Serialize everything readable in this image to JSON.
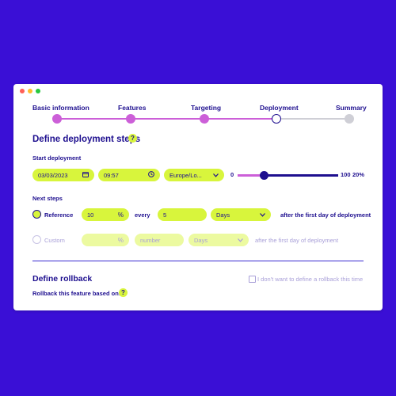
{
  "window": {
    "dot_colors": [
      "#ff5f57",
      "#ffbd2e",
      "#28c840"
    ]
  },
  "stepper": {
    "steps": [
      {
        "label": "Basic information",
        "state": "done"
      },
      {
        "label": "Features",
        "state": "done"
      },
      {
        "label": "Targeting",
        "state": "done"
      },
      {
        "label": "Deployment",
        "state": "current"
      },
      {
        "label": "Summary",
        "state": "todo"
      }
    ]
  },
  "deployment": {
    "title": "Define deployment steps",
    "help": "?",
    "start_label": "Start deployment",
    "date": "03/03/2023",
    "time": "09:57",
    "timezone": "Europe/Lo...",
    "slider": {
      "min": "0",
      "max": "100",
      "value_label": "20%",
      "value": 20
    },
    "next_label": "Next steps",
    "reference": {
      "label": "Reference",
      "percent": "10",
      "percent_sign": "%",
      "every": "every",
      "number": "5",
      "unit": "Days",
      "suffix": "after the first day of deployment"
    },
    "custom": {
      "label": "Custom",
      "percent_placeholder": "",
      "percent_sign": "%",
      "number_placeholder": "number",
      "unit": "Days",
      "suffix": "after the first day of deployment"
    }
  },
  "rollback": {
    "title": "Define rollback",
    "checkbox_label": "I don't want to define a rollback this time",
    "based_on": "Rollback this feature based on:",
    "help": "?"
  },
  "colors": {
    "background": "#3a0fd6",
    "accent_lime": "#d8f53c",
    "accent_pink": "#cc5fd8",
    "navy": "#1e0f8f"
  }
}
